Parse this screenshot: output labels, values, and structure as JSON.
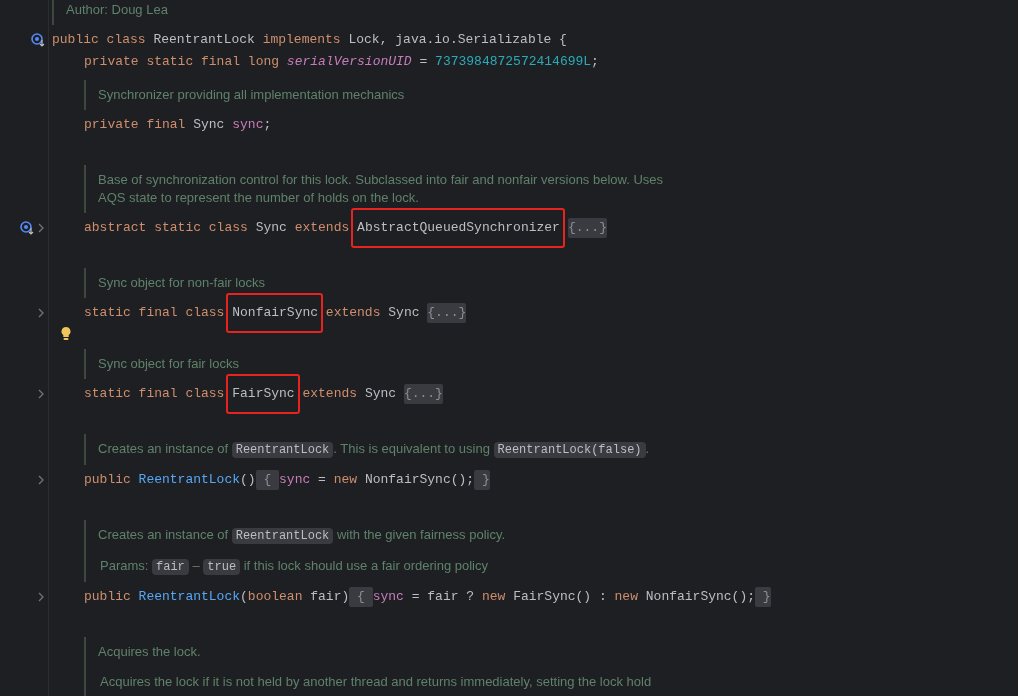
{
  "editor": {
    "author_doc": {
      "paragraphs": [
        [
          {
            "text": "Author: Doug Lea"
          }
        ]
      ]
    },
    "class": {
      "overrides": true,
      "tokens": [
        {
          "text": "public class ",
          "kind": "keyword"
        },
        {
          "text": "ReentrantLock ",
          "kind": "plain"
        },
        {
          "text": "implements ",
          "kind": "keyword"
        },
        {
          "text": "Lock, java.io.Serializable {",
          "kind": "plain"
        }
      ],
      "children": [
        {
          "kind": "code",
          "tokens": [
            {
              "text": "private static final long ",
              "kind": "keyword"
            },
            {
              "text": "serialVersionUID",
              "kind": "constant"
            },
            {
              "text": " = ",
              "kind": "plain"
            },
            {
              "text": "7373984872572414699L",
              "kind": "number"
            },
            {
              "text": ";",
              "kind": "plain"
            }
          ]
        },
        {
          "kind": "doc",
          "paragraphs": [
            [
              {
                "text": "Synchronizer providing all implementation mechanics"
              }
            ]
          ]
        },
        {
          "kind": "code",
          "tokens": [
            {
              "text": "private final ",
              "kind": "keyword"
            },
            {
              "text": "Sync ",
              "kind": "plain"
            },
            {
              "text": "sync",
              "kind": "field"
            },
            {
              "text": ";",
              "kind": "plain"
            }
          ]
        },
        {
          "kind": "doc",
          "spaced": true,
          "paragraphs": [
            [
              {
                "text": "Base of synchronization control for this lock. Subclassed into fair and nonfair versions below. Uses AQS state to represent the number of holds on the lock."
              }
            ]
          ]
        },
        {
          "kind": "code",
          "overrides": true,
          "folded": true,
          "tokens": [
            {
              "text": "abstract static class ",
              "kind": "keyword"
            },
            {
              "text": "Sync ",
              "kind": "plain"
            },
            {
              "text": "extends ",
              "kind": "keyword"
            },
            {
              "text": "AbstractQueuedSynchronizer",
              "kind": "plain",
              "highlighted": true
            },
            {
              "text": "{...}",
              "kind": "folded"
            }
          ]
        },
        {
          "kind": "doc",
          "spaced": true,
          "paragraphs": [
            [
              {
                "text": "Sync object for non-fair locks"
              }
            ]
          ]
        },
        {
          "kind": "code",
          "folded": true,
          "tokens": [
            {
              "text": "static final class ",
              "kind": "keyword"
            },
            {
              "text": "NonfairSync",
              "kind": "plain",
              "highlighted": true
            },
            {
              "text": " extends ",
              "kind": "keyword"
            },
            {
              "text": "Sync ",
              "kind": "plain"
            },
            {
              "text": "{...}",
              "kind": "folded"
            }
          ]
        },
        {
          "kind": "hint"
        },
        {
          "kind": "doc",
          "paragraphs": [
            [
              {
                "text": "Sync object for fair locks"
              }
            ]
          ]
        },
        {
          "kind": "code",
          "folded": true,
          "tokens": [
            {
              "text": "static final class ",
              "kind": "keyword"
            },
            {
              "text": "FairSync",
              "kind": "plain",
              "highlighted": true
            },
            {
              "text": " extends ",
              "kind": "keyword"
            },
            {
              "text": "Sync ",
              "kind": "plain"
            },
            {
              "text": "{...}",
              "kind": "folded"
            }
          ]
        },
        {
          "kind": "doc",
          "spaced": true,
          "paragraphs": [
            [
              {
                "text": "Creates an instance of "
              },
              {
                "text": "ReentrantLock",
                "code": true
              },
              {
                "text": ". This is equivalent to using "
              },
              {
                "text": "ReentrantLock(false)",
                "code": true
              },
              {
                "text": "."
              }
            ]
          ]
        },
        {
          "kind": "code",
          "folded": true,
          "tokens": [
            {
              "text": "public ",
              "kind": "keyword"
            },
            {
              "text": "ReentrantLock",
              "kind": "method"
            },
            {
              "text": "()",
              "kind": "plain"
            },
            {
              "text": " { ",
              "kind": "folded"
            },
            {
              "text": "sync",
              "kind": "field"
            },
            {
              "text": " = ",
              "kind": "plain"
            },
            {
              "text": "new ",
              "kind": "keyword"
            },
            {
              "text": "NonfairSync();",
              "kind": "plain"
            },
            {
              "text": " }",
              "kind": "folded"
            }
          ]
        },
        {
          "kind": "doc",
          "spaced": true,
          "paragraphs": [
            [
              {
                "text": "Creates an instance of "
              },
              {
                "text": "ReentrantLock",
                "code": true
              },
              {
                "text": " with the given fairness policy."
              }
            ],
            [
              {
                "text": "Params: "
              },
              {
                "text": "fair",
                "code": true
              },
              {
                "text": " – "
              },
              {
                "text": "true",
                "code": true
              },
              {
                "text": " if this lock should use a fair ordering policy"
              }
            ]
          ]
        },
        {
          "kind": "code",
          "folded": true,
          "tokens": [
            {
              "text": "public ",
              "kind": "keyword"
            },
            {
              "text": "ReentrantLock",
              "kind": "method"
            },
            {
              "text": "(",
              "kind": "plain"
            },
            {
              "text": "boolean ",
              "kind": "keyword"
            },
            {
              "text": "fair)",
              "kind": "plain"
            },
            {
              "text": " { ",
              "kind": "folded"
            },
            {
              "text": "sync",
              "kind": "field"
            },
            {
              "text": " = fair ? ",
              "kind": "plain"
            },
            {
              "text": "new ",
              "kind": "keyword"
            },
            {
              "text": "FairSync() : ",
              "kind": "plain"
            },
            {
              "text": "new ",
              "kind": "keyword"
            },
            {
              "text": "NonfairSync();",
              "kind": "plain"
            },
            {
              "text": " }",
              "kind": "folded"
            }
          ]
        },
        {
          "kind": "doc",
          "spaced": true,
          "paragraphs": [
            [
              {
                "text": "Acquires the lock."
              }
            ],
            [
              {
                "text": "Acquires the lock if it is not held by another thread and returns immediately, setting the lock hold"
              }
            ]
          ]
        }
      ]
    }
  }
}
